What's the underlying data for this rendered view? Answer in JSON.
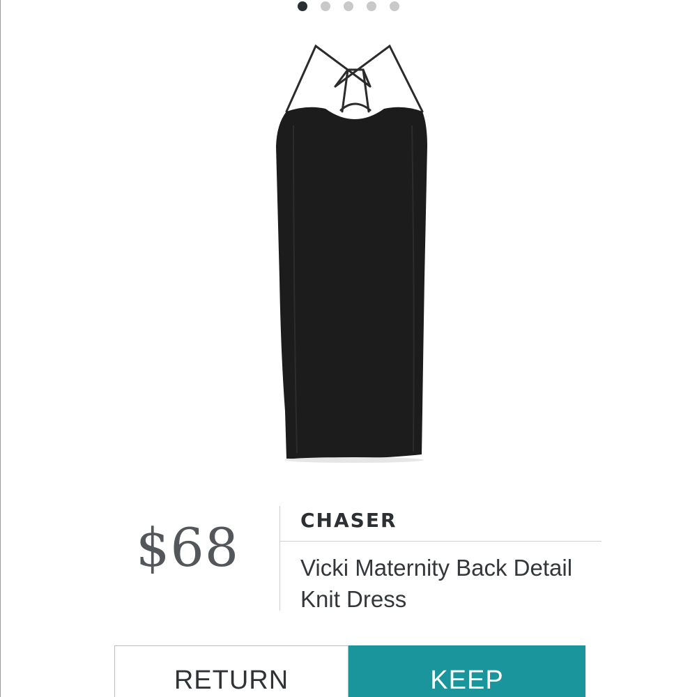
{
  "carousel": {
    "slide_count": 5,
    "active_index": 0,
    "active_color": "#2a2f33",
    "inactive_color": "#c9c9c9"
  },
  "product": {
    "image_icon": "black-dress-image",
    "price": "$68",
    "brand": "CHASER",
    "name": "Vicki Maternity Back Detail Knit Dress"
  },
  "actions": {
    "return_label": "RETURN",
    "keep_label": "KEEP",
    "keep_color": "#1a959b"
  }
}
